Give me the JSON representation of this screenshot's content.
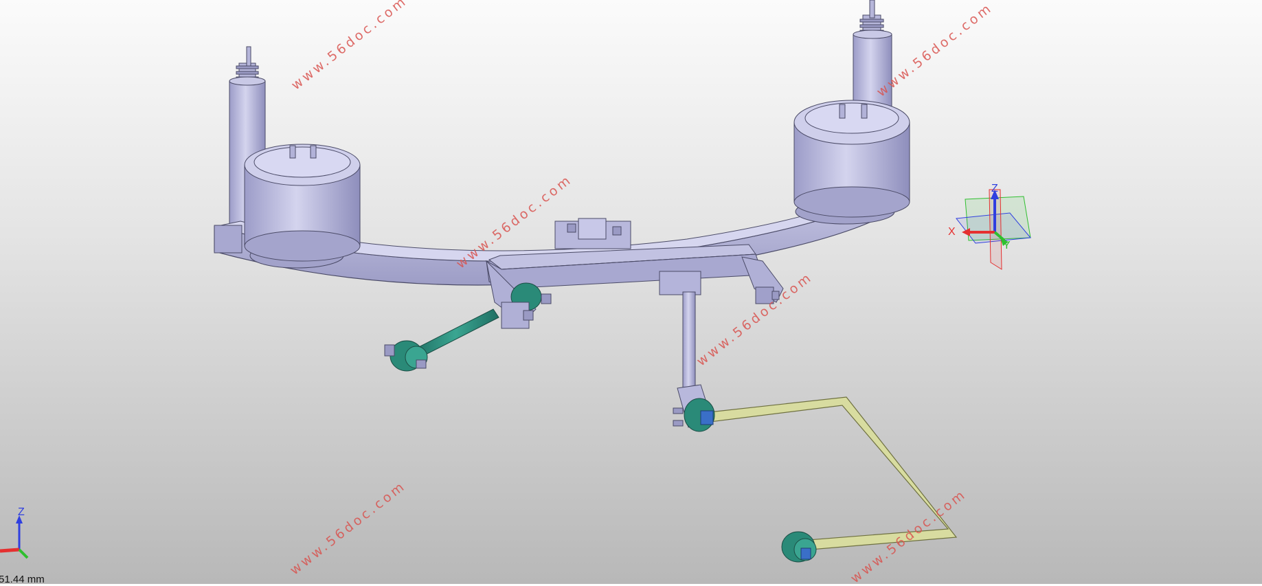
{
  "viewport": {
    "background_top": "#fbfbfb",
    "background_bottom": "#b8b8b8"
  },
  "watermark": {
    "text": "www.56doc.com",
    "color": "#d9534f"
  },
  "compass": {
    "x_label": "X",
    "y_label": "Y",
    "z_label": "Z"
  },
  "mini_axis": {
    "z_label": "Z"
  },
  "scale_readout": "51.44 mm",
  "colors": {
    "part_lavender": "#b8b8dc",
    "part_edge": "#4a4a66",
    "bushing_teal": "#2e8b7a",
    "stabilizer_bar": "#d8dca0",
    "axis_x": "#e53030",
    "axis_y": "#2fbf2f",
    "axis_z": "#2f3fe0"
  }
}
